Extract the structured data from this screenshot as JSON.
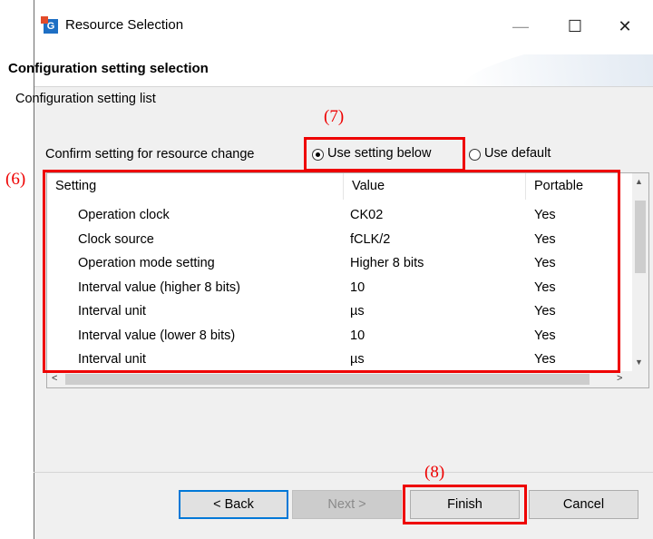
{
  "window": {
    "title": "Resource Selection",
    "app_icon_letter": "G",
    "minimize_glyph": "—",
    "maximize_glyph": "☐",
    "close_glyph": "✕"
  },
  "header": {
    "title": "Configuration setting selection",
    "subtitle": "Configuration setting list"
  },
  "confirm": {
    "label": "Confirm setting for resource change",
    "options": [
      {
        "label": "Use setting below",
        "selected": true
      },
      {
        "label": "Use default",
        "selected": false
      }
    ]
  },
  "table": {
    "columns": [
      "Setting",
      "Value",
      "Portable"
    ],
    "rows": [
      [
        "Operation clock",
        "CK02",
        "Yes"
      ],
      [
        "Clock source",
        "fCLK/2",
        "Yes"
      ],
      [
        "Operation mode setting",
        "Higher 8 bits",
        "Yes"
      ],
      [
        "Interval value (higher 8 bits)",
        "10",
        "Yes"
      ],
      [
        "Interval unit",
        "µs",
        "Yes"
      ],
      [
        "Interval value (lower 8 bits)",
        "10",
        "Yes"
      ],
      [
        "Interval unit",
        "µs",
        "Yes"
      ]
    ]
  },
  "buttons": {
    "back": "< Back",
    "next": "Next >",
    "finish": "Finish",
    "cancel": "Cancel"
  },
  "annotations": {
    "six": "(6)",
    "seven": "(7)",
    "eight": "(8)"
  },
  "colors": {
    "highlight_red": "#ee0000",
    "dialog_bg": "#f0f0f0",
    "focus_blue": "#0078d7"
  }
}
